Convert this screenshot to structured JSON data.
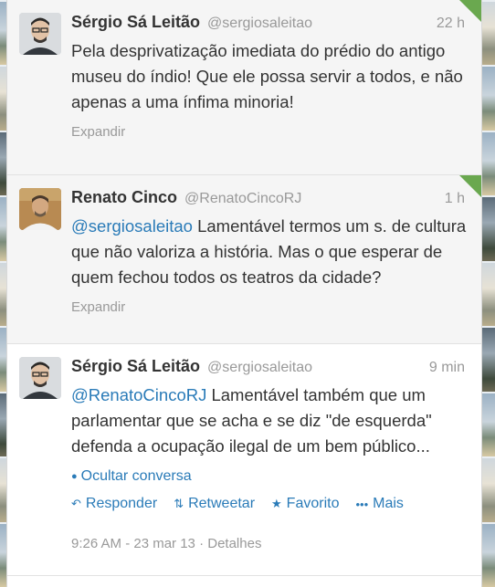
{
  "tweets": [
    {
      "fullname": "Sérgio Sá Leitão",
      "username": "@sergiosaleitao",
      "time": "22 h",
      "mention": "",
      "text": "Pela desprivatização imediata do prédio do antigo museu do índio! Que ele possa servir a todos, e não apenas a uma ínfima minoria!",
      "expand": "Expandir",
      "avatar": "avatar-sergio",
      "retweeted_corner": true
    },
    {
      "fullname": "Renato Cinco",
      "username": "@RenatoCincoRJ",
      "time": "1 h",
      "mention": "@sergiosaleitao",
      "text": " Lamentável termos um s. de cultura que não valoriza a história. Mas o que esperar de quem fechou todos os teatros da cidade?",
      "expand": "Expandir",
      "avatar": "avatar-renato",
      "retweeted_corner": true
    },
    {
      "fullname": "Sérgio Sá Leitão",
      "username": "@sergiosaleitao",
      "time": "9 min",
      "mention": "@RenatoCincoRJ",
      "text": " Lamentável também que um parlamentar que se acha e se diz \"de esquerda\" defenda a ocupação ilegal de um bem público...",
      "conversation": "Ocultar conversa",
      "actions": {
        "reply": "Responder",
        "retweet": "Retweetar",
        "favorite": "Favorito",
        "more": "Mais"
      },
      "timestamp": "9:26 AM - 23 mar 13",
      "details": "Detalhes",
      "separator": " · "
    }
  ],
  "colors": {
    "link": "#2a7bb8",
    "corner": "#6aa84f"
  }
}
